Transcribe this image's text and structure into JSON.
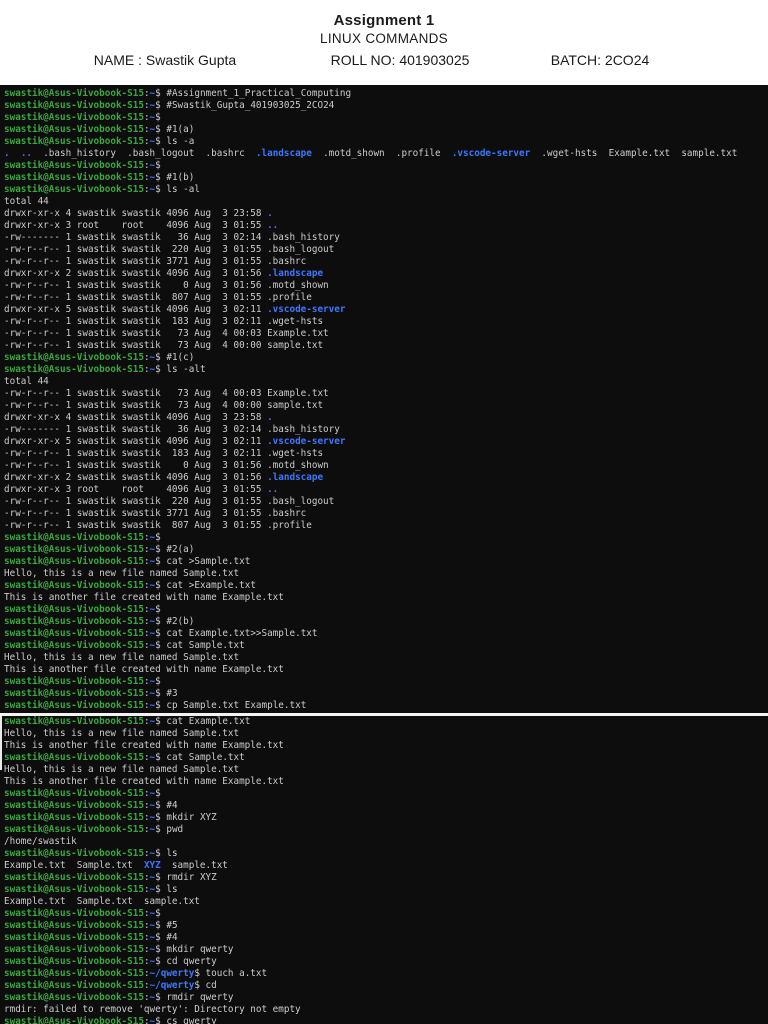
{
  "header": {
    "title": "Assignment 1",
    "subtitle": "LINUX COMMANDS",
    "name_label": "NAME : Swastik Gupta",
    "roll_label": "ROLL NO: 401903025",
    "batch_label": "BATCH: 2CO24"
  },
  "colors": {
    "terminal_bg": "#0d0d0d",
    "terminal_fg": "#cccccc",
    "prompt_green": "#3aa83e",
    "dir_blue": "#3b78ff"
  },
  "terminal": {
    "prompt_user": "swastik@Asus-Vivobook-S15",
    "sections": [
      {
        "id": "terminal-screen-1",
        "lines": [
          [
            "p",
            "~",
            "#Assignment_1_Practical_Computing"
          ],
          [
            "p",
            "~",
            "#Swastik_Gupta_401903025_2CO24"
          ],
          [
            "p",
            "~"
          ],
          [
            "p",
            "~",
            "#1(a)"
          ],
          [
            "p",
            "~",
            "ls -a"
          ],
          [
            "s",
            [
              [
                "b",
                "."
              ],
              [
                "w",
                "  "
              ],
              [
                "b",
                ".."
              ],
              [
                "w",
                "  .bash_history  .bash_logout  .bashrc  "
              ],
              [
                "b",
                ".landscape"
              ],
              [
                "w",
                "  .motd_shown  .profile  "
              ],
              [
                "b",
                ".vscode-server"
              ],
              [
                "w",
                "  .wget-hsts  Example.txt  sample.txt"
              ]
            ]
          ],
          [
            "p",
            "~"
          ],
          [
            "p",
            "~",
            "#1(b)"
          ],
          [
            "p",
            "~",
            "ls -al"
          ],
          [
            "o",
            "total 44"
          ],
          [
            "s",
            [
              [
                "w",
                "drwxr-xr-x 4 swastik swastik 4096 Aug  3 23:58 "
              ],
              [
                "b",
                "."
              ]
            ]
          ],
          [
            "s",
            [
              [
                "w",
                "drwxr-xr-x 3 root    root    4096 Aug  3 01:55 "
              ],
              [
                "b",
                ".."
              ]
            ]
          ],
          [
            "o",
            "-rw------- 1 swastik swastik   36 Aug  3 02:14 .bash_history"
          ],
          [
            "o",
            "-rw-r--r-- 1 swastik swastik  220 Aug  3 01:55 .bash_logout"
          ],
          [
            "o",
            "-rw-r--r-- 1 swastik swastik 3771 Aug  3 01:55 .bashrc"
          ],
          [
            "s",
            [
              [
                "w",
                "drwxr-xr-x 2 swastik swastik 4096 Aug  3 01:56 "
              ],
              [
                "b",
                ".landscape"
              ]
            ]
          ],
          [
            "o",
            "-rw-r--r-- 1 swastik swastik    0 Aug  3 01:56 .motd_shown"
          ],
          [
            "o",
            "-rw-r--r-- 1 swastik swastik  807 Aug  3 01:55 .profile"
          ],
          [
            "s",
            [
              [
                "w",
                "drwxr-xr-x 5 swastik swastik 4096 Aug  3 02:11 "
              ],
              [
                "b",
                ".vscode-server"
              ]
            ]
          ],
          [
            "o",
            "-rw-r--r-- 1 swastik swastik  183 Aug  3 02:11 .wget-hsts"
          ],
          [
            "o",
            "-rw-r--r-- 1 swastik swastik   73 Aug  4 00:03 Example.txt"
          ],
          [
            "o",
            "-rw-r--r-- 1 swastik swastik   73 Aug  4 00:00 sample.txt"
          ],
          [
            "p",
            "~",
            "#1(c)"
          ],
          [
            "p",
            "~",
            "ls -alt"
          ],
          [
            "o",
            "total 44"
          ],
          [
            "o",
            "-rw-r--r-- 1 swastik swastik   73 Aug  4 00:03 Example.txt"
          ],
          [
            "o",
            "-rw-r--r-- 1 swastik swastik   73 Aug  4 00:00 sample.txt"
          ],
          [
            "s",
            [
              [
                "w",
                "drwxr-xr-x 4 swastik swastik 4096 Aug  3 23:58 "
              ],
              [
                "b",
                "."
              ]
            ]
          ],
          [
            "o",
            "-rw------- 1 swastik swastik   36 Aug  3 02:14 .bash_history"
          ],
          [
            "s",
            [
              [
                "w",
                "drwxr-xr-x 5 swastik swastik 4096 Aug  3 02:11 "
              ],
              [
                "b",
                ".vscode-server"
              ]
            ]
          ],
          [
            "o",
            "-rw-r--r-- 1 swastik swastik  183 Aug  3 02:11 .wget-hsts"
          ],
          [
            "o",
            "-rw-r--r-- 1 swastik swastik    0 Aug  3 01:56 .motd_shown"
          ],
          [
            "s",
            [
              [
                "w",
                "drwxr-xr-x 2 swastik swastik 4096 Aug  3 01:56 "
              ],
              [
                "b",
                ".landscape"
              ]
            ]
          ],
          [
            "s",
            [
              [
                "w",
                "drwxr-xr-x 3 root    root    4096 Aug  3 01:55 "
              ],
              [
                "b",
                ".."
              ]
            ]
          ],
          [
            "o",
            "-rw-r--r-- 1 swastik swastik  220 Aug  3 01:55 .bash_logout"
          ],
          [
            "o",
            "-rw-r--r-- 1 swastik swastik 3771 Aug  3 01:55 .bashrc"
          ],
          [
            "o",
            "-rw-r--r-- 1 swastik swastik  807 Aug  3 01:55 .profile"
          ],
          [
            "p",
            "~"
          ],
          [
            "p",
            "~",
            "#2(a)"
          ],
          [
            "p",
            "~",
            "cat >Sample.txt"
          ],
          [
            "o",
            "Hello, this is a new file named Sample.txt"
          ],
          [
            "p",
            "~",
            "cat >Example.txt"
          ],
          [
            "o",
            "This is another file created with name Example.txt"
          ],
          [
            "p",
            "~"
          ],
          [
            "p",
            "~",
            "#2(b)"
          ],
          [
            "p",
            "~",
            "cat Example.txt>>Sample.txt"
          ],
          [
            "p",
            "~",
            "cat Sample.txt"
          ],
          [
            "o",
            "Hello, this is a new file named Sample.txt"
          ],
          [
            "o",
            "This is another file created with name Example.txt"
          ],
          [
            "p",
            "~"
          ],
          [
            "p",
            "~",
            "#3"
          ],
          [
            "p",
            "~",
            "cp Sample.txt Example.txt"
          ]
        ]
      },
      {
        "id": "terminal-screen-2",
        "lines": [
          [
            "p",
            "~",
            "cat Example.txt"
          ],
          [
            "o",
            "Hello, this is a new file named Sample.txt"
          ],
          [
            "o",
            "This is another file created with name Example.txt"
          ],
          [
            "p",
            "~",
            "cat Sample.txt"
          ],
          [
            "o",
            "Hello, this is a new file named Sample.txt"
          ],
          [
            "o",
            "This is another file created with name Example.txt"
          ],
          [
            "p",
            "~"
          ],
          [
            "p",
            "~",
            "#4"
          ],
          [
            "p",
            "~",
            "mkdir XYZ"
          ],
          [
            "p",
            "~",
            "pwd"
          ],
          [
            "o",
            "/home/swastik"
          ],
          [
            "p",
            "~",
            "ls"
          ],
          [
            "s",
            [
              [
                "w",
                "Example.txt  Sample.txt  "
              ],
              [
                "b",
                "XYZ"
              ],
              [
                "w",
                "  sample.txt"
              ]
            ]
          ],
          [
            "p",
            "~",
            "rmdir XYZ"
          ],
          [
            "p",
            "~",
            "ls"
          ],
          [
            "o",
            "Example.txt  Sample.txt  sample.txt"
          ],
          [
            "p",
            "~"
          ],
          [
            "p",
            "~",
            "#5"
          ],
          [
            "p",
            "~",
            "#4"
          ],
          [
            "p",
            "~",
            "mkdir qwerty"
          ],
          [
            "p",
            "~",
            "cd qwerty"
          ],
          [
            "p",
            "~/qwerty",
            "touch a.txt"
          ],
          [
            "p",
            "~/qwerty",
            "cd"
          ],
          [
            "p",
            "~",
            "rmdir qwerty"
          ],
          [
            "o",
            "rmdir: failed to remove 'qwerty': Directory not empty"
          ],
          [
            "p",
            "~",
            "cs qwerty"
          ]
        ]
      }
    ]
  }
}
